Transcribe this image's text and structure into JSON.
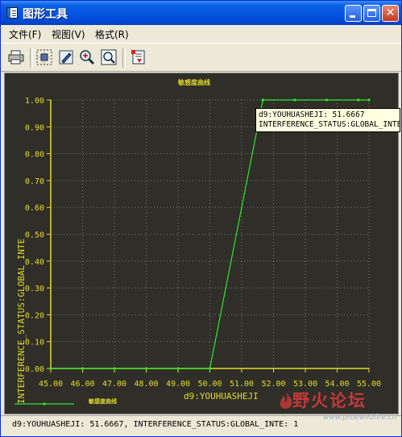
{
  "window": {
    "title": "图形工具"
  },
  "menubar": {
    "items": [
      "文件(F)",
      "视图(V)",
      "格式(R)"
    ]
  },
  "toolbar": {
    "icons": [
      "print-icon",
      "select-grid-icon",
      "edit-icon",
      "zoom-in-icon",
      "zoom-fit-icon",
      "export-icon"
    ]
  },
  "chart": {
    "title": "敏感度曲线",
    "xlabel": "d9:YOUHUASHEJI",
    "ylabel": "INTERFERENCE_STATUS:GLOBAL_INTE",
    "legend": "敏感度曲线",
    "tooltip": [
      "d9:YOUHUASHEJI: 51.6667",
      "INTERFERENCE_STATUS:GLOBAL_INTE"
    ]
  },
  "chart_data": {
    "type": "line",
    "x": [
      45.0,
      46.0,
      47.0,
      48.0,
      49.0,
      50.0,
      51.0,
      52.0,
      53.0,
      54.0,
      55.0
    ],
    "x_ticks": [
      "45.00",
      "46.00",
      "47.00",
      "48.00",
      "49.00",
      "50.00",
      "51.00",
      "52.00",
      "53.00",
      "54.00",
      "55.00"
    ],
    "y_ticks": [
      "0.00",
      "0.10",
      "0.20",
      "0.30",
      "0.40",
      "0.50",
      "0.60",
      "0.70",
      "0.80",
      "0.90",
      "1.00"
    ],
    "xlim": [
      45,
      55
    ],
    "ylim": [
      0,
      1
    ],
    "grid": true,
    "series": [
      {
        "name": "敏感度曲线",
        "color": "#2ee82e",
        "points": [
          [
            45.0,
            0
          ],
          [
            46.0,
            0
          ],
          [
            47.0,
            0
          ],
          [
            48.0,
            0
          ],
          [
            49.0,
            0
          ],
          [
            50.0,
            0
          ],
          [
            51.6667,
            1
          ],
          [
            52.6667,
            1
          ],
          [
            53.6667,
            1
          ],
          [
            54.6667,
            1
          ],
          [
            55.0,
            1
          ]
        ]
      }
    ]
  },
  "statusbar": {
    "text": "d9:YOUHUASHEJI: 51.6667, INTERFERENCE_STATUS:GLOBAL_INTE: 1"
  },
  "watermark": {
    "text": "野火论坛",
    "url": "www.proewildfire.cn"
  }
}
